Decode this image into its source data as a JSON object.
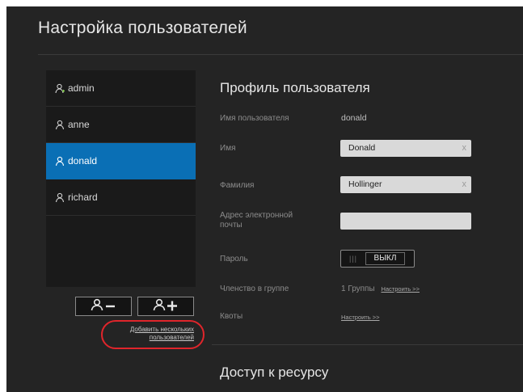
{
  "page": {
    "title": "Настройка пользователей"
  },
  "users": [
    {
      "name": "admin",
      "selected": false,
      "icon": "user-admin-icon"
    },
    {
      "name": "anne",
      "selected": false,
      "icon": "user-icon"
    },
    {
      "name": "donald",
      "selected": true,
      "icon": "user-icon"
    },
    {
      "name": "richard",
      "selected": false,
      "icon": "user-icon"
    }
  ],
  "actions": {
    "remove_user_icon": "user-minus-icon",
    "add_user_icon": "user-plus-icon",
    "add_multiple_line1": "Добавить нескольких",
    "add_multiple_line2": "пользователей"
  },
  "profile": {
    "title": "Профиль пользователя",
    "username_label": "Имя пользователя",
    "username_value": "donald",
    "first_name_label": "Имя",
    "first_name_value": "Donald",
    "last_name_label": "Фамилия",
    "last_name_value": "Hollinger",
    "email_label_line1": "Адрес электронной",
    "email_label_line2": "почты",
    "email_value": "",
    "password_label": "Пароль",
    "password_toggle_state": "ВЫКЛ",
    "group_label": "Членство в группе",
    "group_value": "1 Группы",
    "group_link": "Настроить >>",
    "quota_label": "Квоты",
    "quota_link": "Настроить >>",
    "clear_glyph": "x"
  },
  "share_access": {
    "title": "Доступ к ресурсу"
  },
  "colors": {
    "background": "#242424",
    "accent_selected": "#0a6fb5",
    "highlight_ring": "#e0252b"
  }
}
